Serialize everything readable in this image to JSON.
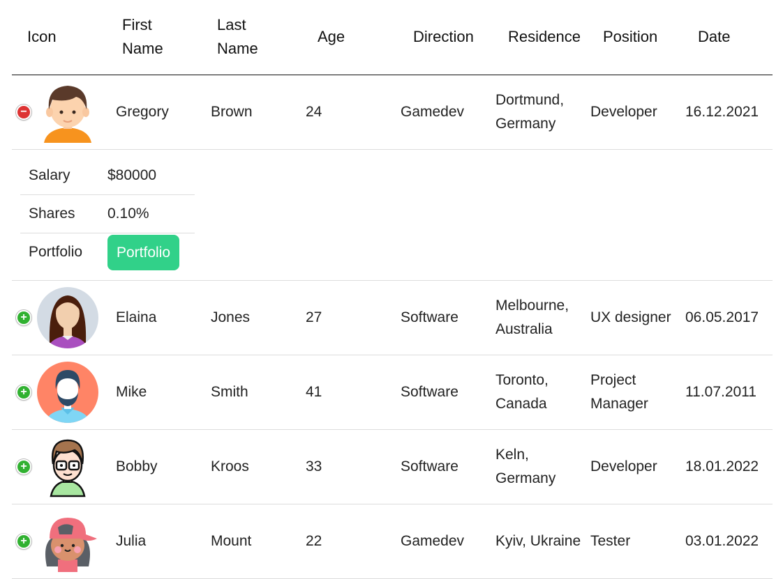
{
  "columns": [
    "Icon",
    "First Name",
    "Last Name",
    "Age",
    "Direction",
    "Residence",
    "Position",
    "Date"
  ],
  "rows": [
    {
      "expanded": true,
      "toggle_icon": "minus-circle-icon",
      "avatar": "boy-avatar",
      "first": "Gregory",
      "last": "Brown",
      "age": "24",
      "direction": "Gamedev",
      "residence": "Dortmund, Germany",
      "position": "Developer",
      "date": "16.12.2021"
    },
    {
      "expanded": false,
      "toggle_icon": "plus-circle-icon",
      "avatar": "woman-avatar",
      "first": "Elaina",
      "last": "Jones",
      "age": "27",
      "direction": "Software",
      "residence": "Melbourne, Australia",
      "position": "UX designer",
      "date": "06.05.2017"
    },
    {
      "expanded": false,
      "toggle_icon": "plus-circle-icon",
      "avatar": "bearded-man-avatar",
      "first": "Mike",
      "last": "Smith",
      "age": "41",
      "direction": "Software",
      "residence": "Toronto, Canada",
      "position": "Project Manager",
      "date": "11.07.2011"
    },
    {
      "expanded": false,
      "toggle_icon": "plus-circle-icon",
      "avatar": "glasses-man-avatar",
      "first": "Bobby",
      "last": "Kroos",
      "age": "33",
      "direction": "Software",
      "residence": "Keln, Germany",
      "position": "Developer",
      "date": "18.01.2022"
    },
    {
      "expanded": false,
      "toggle_icon": "plus-circle-icon",
      "avatar": "cap-girl-avatar",
      "first": "Julia",
      "last": "Mount",
      "age": "22",
      "direction": "Gamedev",
      "residence": "Kyiv, Ukraine",
      "position": "Tester",
      "date": "03.01.2022"
    }
  ],
  "detail": {
    "salary_label": "Salary",
    "salary_value": "$80000",
    "shares_label": "Shares",
    "shares_value": "0.10%",
    "portfolio_label": "Portfolio",
    "portfolio_button": "Portfolio"
  },
  "colors": {
    "minus": "#dd3333",
    "plus": "#31b131",
    "portfolio": "#31d189"
  }
}
